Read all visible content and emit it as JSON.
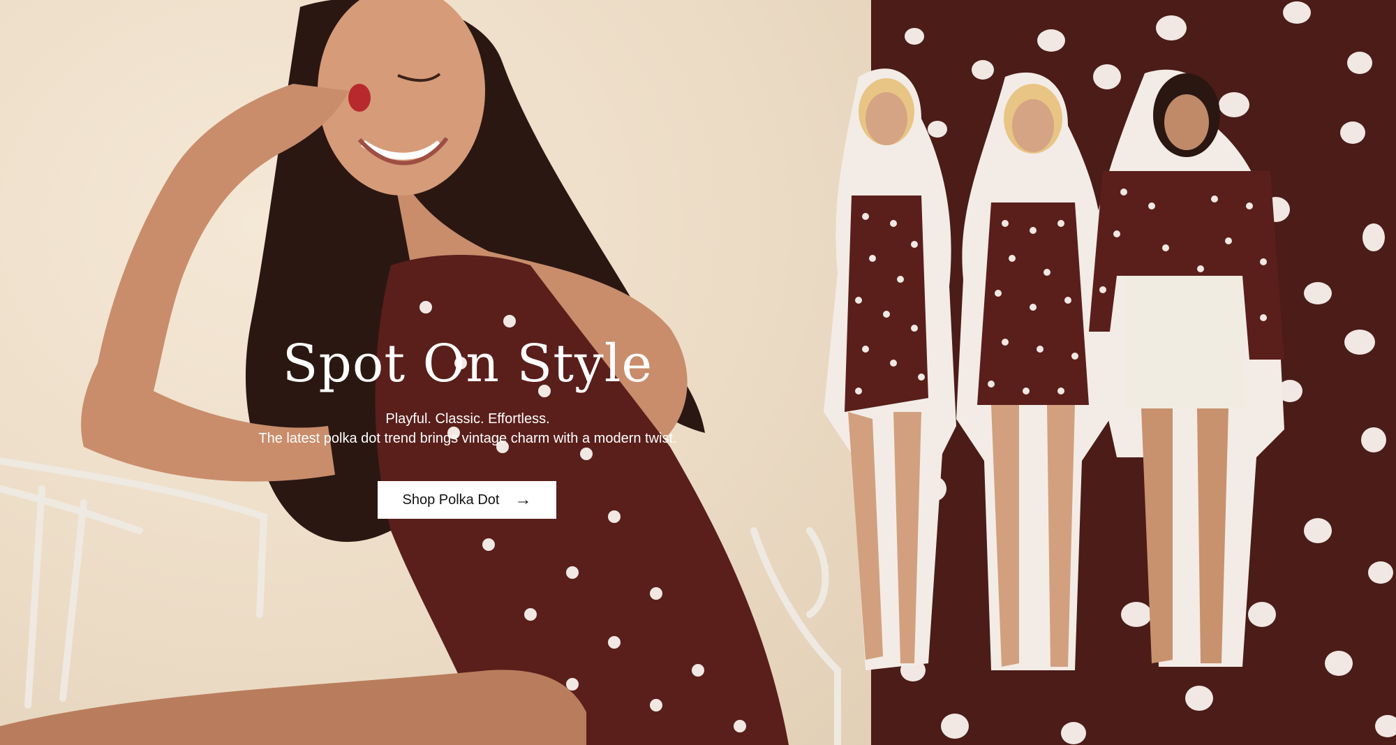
{
  "hero": {
    "headline": "Spot On Style",
    "tagline_line1": "Playful. Classic. Effortless.",
    "tagline_line2": "The latest polka dot trend brings vintage charm with a modern twist.",
    "cta_label": "Shop Polka Dot",
    "cta_icon": "arrow-right-icon",
    "cta_arrow": "→"
  },
  "colors": {
    "left_background": "#ecdcc6",
    "right_background": "#4b1c18",
    "dress_brown": "#5a1f1b",
    "polka_dot": "#f1e8e4",
    "cta_background": "#ffffff",
    "text_white": "#ffffff"
  }
}
